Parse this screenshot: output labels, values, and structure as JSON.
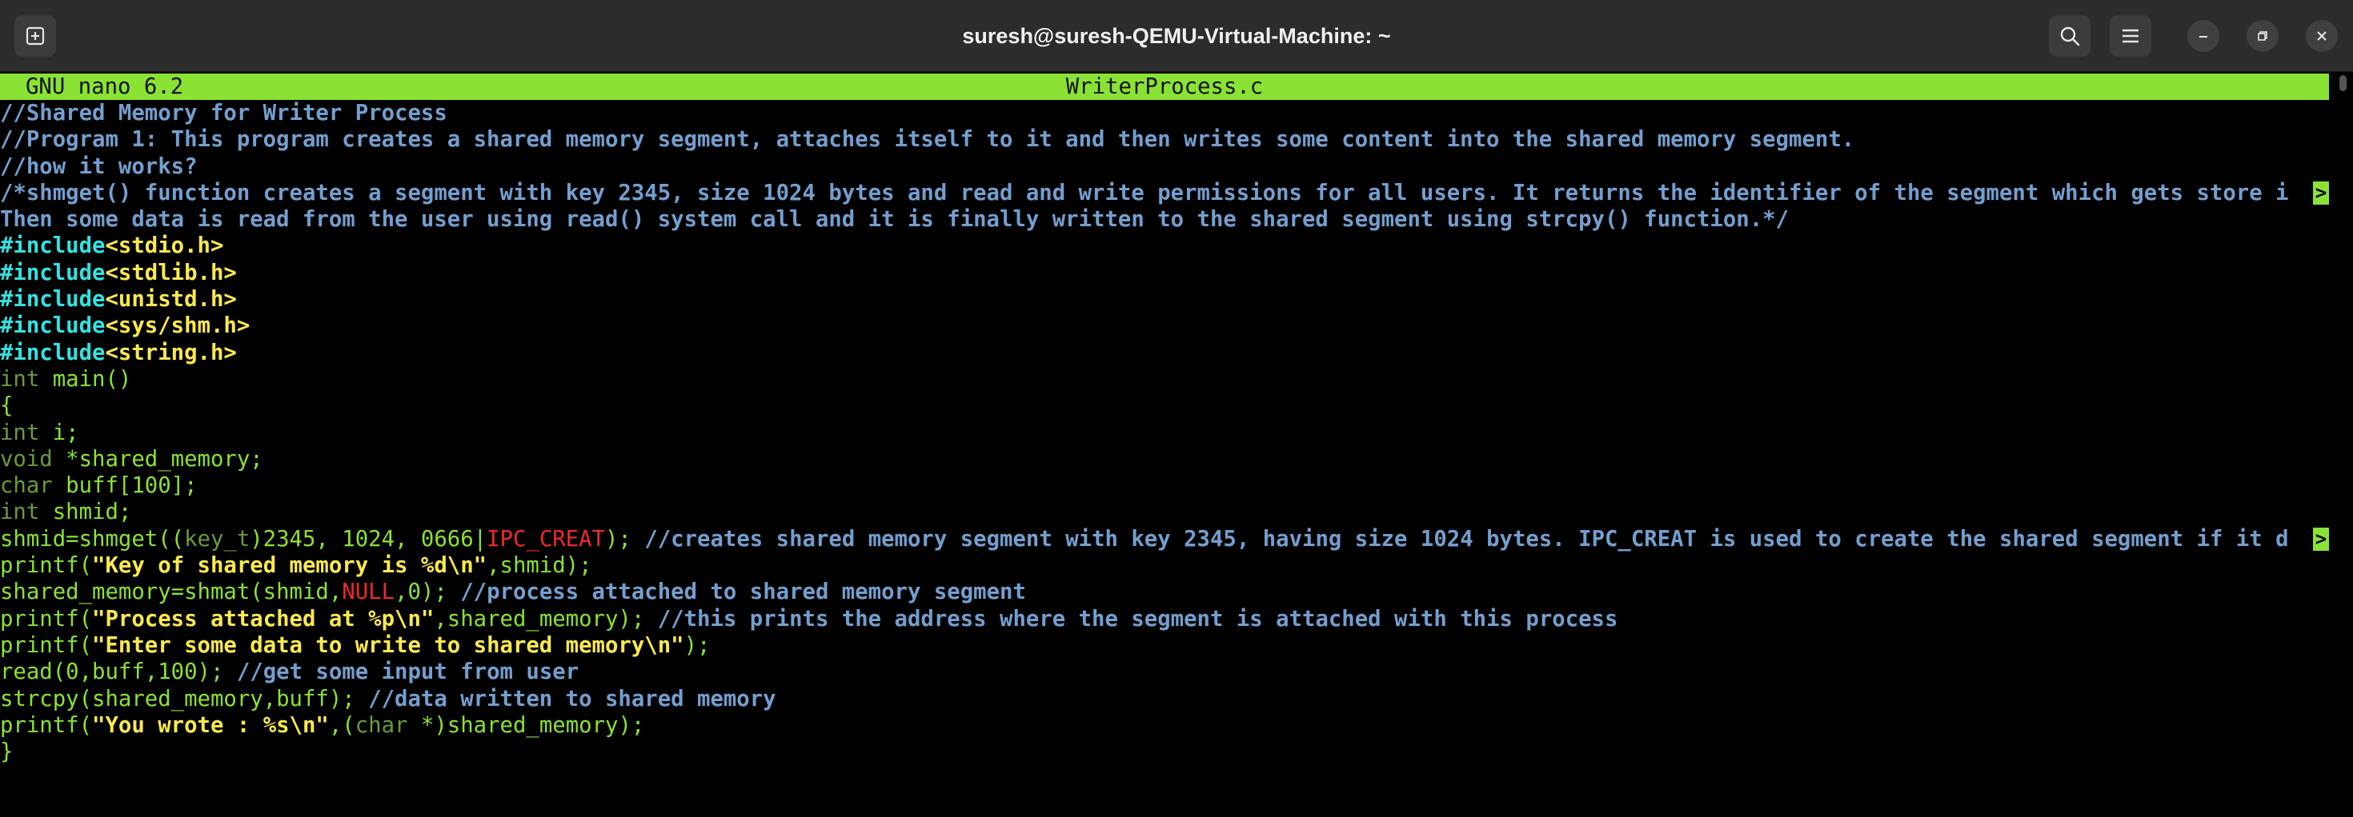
{
  "window": {
    "title": "suresh@suresh-QEMU-Virtual-Machine: ~"
  },
  "icons": {
    "new_tab": "new-tab-icon",
    "search": "search-icon",
    "menu": "hamburger-menu-icon",
    "minimize": "minimize-icon",
    "maximize": "maximize-icon",
    "close": "close-icon"
  },
  "nano": {
    "version": "GNU nano 6.2",
    "filename": "WriterProcess.c"
  },
  "colors": {
    "status_bar": "#8ae234",
    "comment": "#729fcf",
    "include": "#34e2e2",
    "header": "#fce94f",
    "type": "#6a9a3a",
    "code": "#8ae234",
    "string": "#fce94f",
    "macro": "#ef2929",
    "background": "#000000",
    "titlebar": "#2c2c2c"
  },
  "overflow_marker": ">",
  "lines": [
    [
      {
        "t": "//Shared Memory for Writer Process",
        "c": "c-com"
      }
    ],
    [
      {
        "t": "//Program 1: This program creates a shared memory segment, attaches itself to it and then writes some content into the shared memory segment.",
        "c": "c-com"
      }
    ],
    [
      {
        "t": "//how it works?",
        "c": "c-com"
      }
    ],
    [
      {
        "t": "/*shmget() function creates a segment with key 2345, size 1024 bytes and read and write permissions for all users. It returns the identifier of the segment which gets store i",
        "c": "c-com"
      }
    ],
    [
      {
        "t": "Then some data is read from the user using read() system call and it is finally written to the shared segment using strcpy() function.*/",
        "c": "c-com"
      }
    ],
    [
      {
        "t": "#include",
        "c": "c-inc"
      },
      {
        "t": "<stdio.h>",
        "c": "c-hdr"
      }
    ],
    [
      {
        "t": "#include",
        "c": "c-inc"
      },
      {
        "t": "<stdlib.h>",
        "c": "c-hdr"
      }
    ],
    [
      {
        "t": "#include",
        "c": "c-inc"
      },
      {
        "t": "<unistd.h>",
        "c": "c-hdr"
      }
    ],
    [
      {
        "t": "#include",
        "c": "c-inc"
      },
      {
        "t": "<sys/shm.h>",
        "c": "c-hdr"
      }
    ],
    [
      {
        "t": "#include",
        "c": "c-inc"
      },
      {
        "t": "<string.h>",
        "c": "c-hdr"
      }
    ],
    [
      {
        "t": "int",
        "c": "c-typ"
      },
      {
        "t": " main()",
        "c": "c-fn"
      }
    ],
    [
      {
        "t": "{",
        "c": "c-fn"
      }
    ],
    [
      {
        "t": "int",
        "c": "c-typ"
      },
      {
        "t": " i;",
        "c": "c-fn"
      }
    ],
    [
      {
        "t": "void",
        "c": "c-typ"
      },
      {
        "t": " *shared_memory;",
        "c": "c-fn"
      }
    ],
    [
      {
        "t": "char",
        "c": "c-typ"
      },
      {
        "t": " buff[100];",
        "c": "c-fn"
      }
    ],
    [
      {
        "t": "int",
        "c": "c-typ"
      },
      {
        "t": " shmid;",
        "c": "c-fn"
      }
    ],
    [
      {
        "t": "shmid=shmget((",
        "c": "c-fn"
      },
      {
        "t": "key_t",
        "c": "c-typ"
      },
      {
        "t": ")2345, 1024, 0666|",
        "c": "c-fn"
      },
      {
        "t": "IPC_CREAT",
        "c": "c-red"
      },
      {
        "t": "); ",
        "c": "c-fn"
      },
      {
        "t": "//creates shared memory segment with key 2345, having size 1024 bytes. IPC_CREAT is used to create the shared segment if it d",
        "c": "c-com"
      }
    ],
    [
      {
        "t": "printf(",
        "c": "c-fn"
      },
      {
        "t": "\"Key of shared memory is %d\\n\"",
        "c": "c-str"
      },
      {
        "t": ",shmid);",
        "c": "c-fn"
      }
    ],
    [
      {
        "t": "shared_memory=shmat(shmid,",
        "c": "c-fn"
      },
      {
        "t": "NULL",
        "c": "c-red"
      },
      {
        "t": ",0); ",
        "c": "c-fn"
      },
      {
        "t": "//process attached to shared memory segment",
        "c": "c-com"
      }
    ],
    [
      {
        "t": "printf(",
        "c": "c-fn"
      },
      {
        "t": "\"Process attached at %p\\n\"",
        "c": "c-str"
      },
      {
        "t": ",shared_memory); ",
        "c": "c-fn"
      },
      {
        "t": "//this prints the address where the segment is attached with this process",
        "c": "c-com"
      }
    ],
    [
      {
        "t": "printf(",
        "c": "c-fn"
      },
      {
        "t": "\"Enter some data to write to shared memory\\n\"",
        "c": "c-str"
      },
      {
        "t": ");",
        "c": "c-fn"
      }
    ],
    [
      {
        "t": "read(0,buff,100); ",
        "c": "c-fn"
      },
      {
        "t": "//get some input from user",
        "c": "c-com"
      }
    ],
    [
      {
        "t": "strcpy(shared_memory,buff); ",
        "c": "c-fn"
      },
      {
        "t": "//data written to shared memory",
        "c": "c-com"
      }
    ],
    [
      {
        "t": "printf(",
        "c": "c-fn"
      },
      {
        "t": "\"You wrote : %s\\n\"",
        "c": "c-str"
      },
      {
        "t": ",(",
        "c": "c-fn"
      },
      {
        "t": "char",
        "c": "c-typ"
      },
      {
        "t": " *)shared_memory);",
        "c": "c-fn"
      }
    ],
    [
      {
        "t": "}",
        "c": "c-fn"
      }
    ]
  ],
  "overflow_lines": [
    3,
    16
  ]
}
